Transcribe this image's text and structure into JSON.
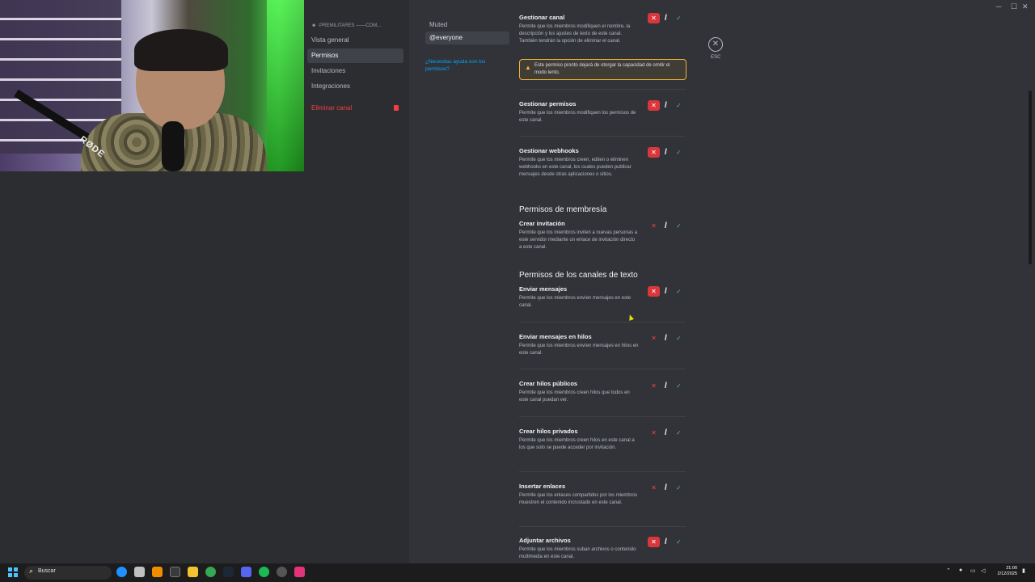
{
  "taskbar": {
    "search_placeholder": "Buscar",
    "time": "21:00",
    "date": "2/12/2025"
  },
  "sidebar": {
    "server_line": "☻ ·PREMILITARES ——COM...",
    "items": [
      {
        "label": "Vista general"
      },
      {
        "label": "Permisos"
      },
      {
        "label": "Invitaciones"
      },
      {
        "label": "Integraciones"
      }
    ],
    "delete_label": "Eliminar canal"
  },
  "roles": {
    "items": [
      {
        "label": "Muted"
      },
      {
        "label": "@everyone"
      }
    ],
    "help_link": "¿Necesitas ayuda con los permisos?"
  },
  "esc": {
    "label": "ESC"
  },
  "warning": {
    "text": "Este permiso pronto dejará de otorgar la capacidad de omitir el modo lento."
  },
  "sections": {
    "membership": "Permisos de membresía",
    "text_channels": "Permisos de los canales de texto"
  },
  "permissions": [
    {
      "title": "Gestionar canal",
      "desc": "Permite que los miembros modifiquen el nombre, la descripción y los ajustes de texto de este canal. También tendrán la opción de eliminar el canal.",
      "state": "deny"
    },
    {
      "title": "Gestionar permisos",
      "desc": "Permite que los miembros modifiquen los permisos de este canal.",
      "state": "deny"
    },
    {
      "title": "Gestionar webhooks",
      "desc": "Permite que los miembros creen, editen o eliminen webhooks en este canal, los cuales pueden publicar mensajes desde otras aplicaciones o sitios.",
      "state": "deny"
    },
    {
      "title": "Crear invitación",
      "desc": "Permite que los miembros inviten a nuevas personas a este servidor mediante un enlace de invitación directo a este canal.",
      "state": "neutral"
    },
    {
      "title": "Enviar mensajes",
      "desc": "Permite que los miembros envíen mensajes en este canal.",
      "state": "deny"
    },
    {
      "title": "Enviar mensajes en hilos",
      "desc": "Permite que los miembros envíen mensajes en hilos en este canal.",
      "state": "neutral"
    },
    {
      "title": "Crear hilos públicos",
      "desc": "Permite que los miembros creen hilos que todos en este canal puedan ver.",
      "state": "neutral"
    },
    {
      "title": "Crear hilos privados",
      "desc": "Permite que los miembros creen hilos en este canal a los que solo se puede acceder por invitación.",
      "state": "neutral"
    },
    {
      "title": "Insertar enlaces",
      "desc": "Permite que los enlaces compartidos por los miembros muestren el contenido incrustado en este canal.",
      "state": "neutral"
    },
    {
      "title": "Adjuntar archivos",
      "desc": "Permite que los miembros suban archivos o contenido multimedia en este canal.",
      "state": "deny"
    }
  ],
  "toggle_glyphs": {
    "deny": "✕",
    "neutral": "/",
    "allow": "✓"
  },
  "colors": {
    "background": "#313338",
    "sidebar": "#2b2d31",
    "danger": "#da373c",
    "allow": "#5fb87a",
    "warning": "#f0b232",
    "link": "#00a8fc"
  }
}
